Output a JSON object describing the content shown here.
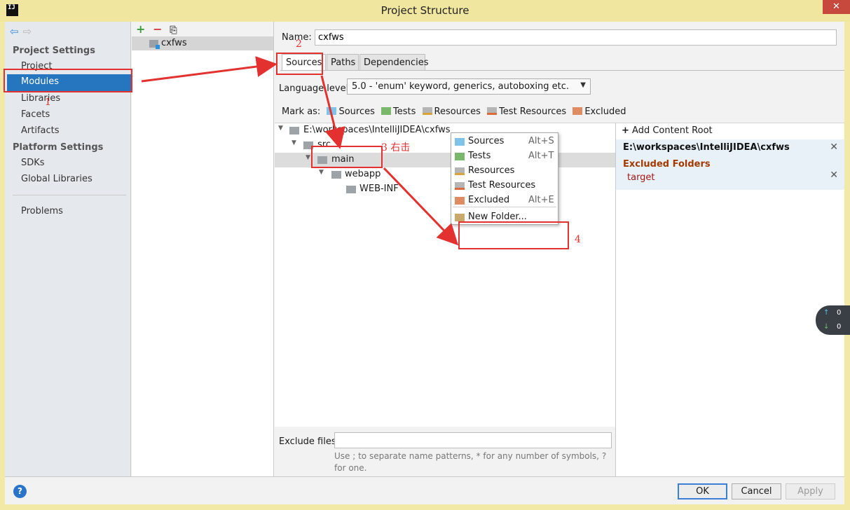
{
  "window": {
    "title": "Project Structure",
    "app_icon_text": "IJ",
    "close_glyph": "✕"
  },
  "sidebar": {
    "section_project": "Project Settings",
    "project_items": [
      "Project",
      "Modules",
      "Libraries",
      "Facets",
      "Artifacts"
    ],
    "section_platform": "Platform Settings",
    "platform_items": [
      "SDKs",
      "Global Libraries"
    ],
    "problems": "Problems",
    "selected": "Modules"
  },
  "modules": {
    "add_icon": "+",
    "remove_icon": "−",
    "copy_icon": "⎘",
    "items": [
      "cxfws"
    ]
  },
  "name": {
    "label": "Name:",
    "value": "cxfws"
  },
  "tabs": [
    "Sources",
    "Paths",
    "Dependencies"
  ],
  "language": {
    "label": "Language level:",
    "value": "5.0 - 'enum' keyword, generics, autoboxing etc."
  },
  "mark_as": {
    "label": "Mark as:",
    "items": [
      "Sources",
      "Tests",
      "Resources",
      "Test Resources",
      "Excluded"
    ]
  },
  "tree": {
    "root": "E:\\workspaces\\IntelliJIDEA\\cxfws",
    "src": "src",
    "main": "main",
    "webapp": "webapp",
    "webinf": "WEB-INF"
  },
  "context_menu": {
    "items": [
      {
        "label": "Sources",
        "shortcut": "Alt+S"
      },
      {
        "label": "Tests",
        "shortcut": "Alt+T"
      },
      {
        "label": "Resources",
        "shortcut": ""
      },
      {
        "label": "Test Resources",
        "shortcut": ""
      },
      {
        "label": "Excluded",
        "shortcut": "Alt+E"
      }
    ],
    "new_folder": "New Folder..."
  },
  "content_root": {
    "add_label": "Add Content Root",
    "path": "E:\\workspaces\\IntelliJIDEA\\cxfws",
    "excluded_header": "Excluded Folders",
    "excluded_items": [
      "target"
    ]
  },
  "exclude_files": {
    "label": "Exclude files:",
    "hint": "Use ; to separate name patterns, * for any number of symbols, ? for one."
  },
  "footer": {
    "help": "?",
    "ok": "OK",
    "cancel": "Cancel",
    "apply": "Apply"
  },
  "network_widget": {
    "up_value": "0",
    "down_value": "0"
  },
  "annotations": {
    "a1": "1",
    "a2": "2",
    "a3": "3 右击",
    "a4": "4",
    "color": "#e3312f"
  }
}
